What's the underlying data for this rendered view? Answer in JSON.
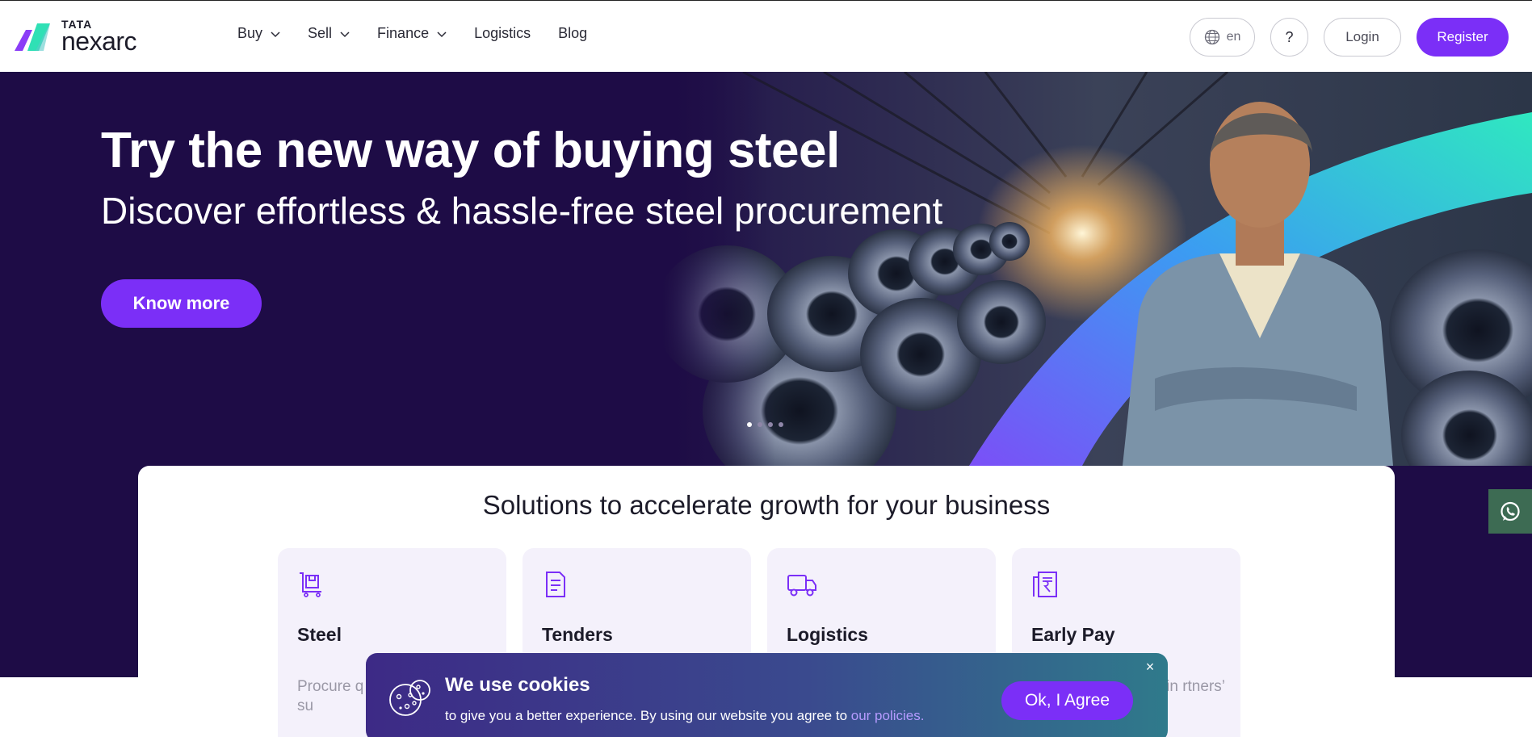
{
  "header": {
    "logo": {
      "brand_top": "TATA",
      "brand_main": "nexarc"
    },
    "nav": [
      {
        "label": "Buy",
        "has_dropdown": true
      },
      {
        "label": "Sell",
        "has_dropdown": true
      },
      {
        "label": "Finance",
        "has_dropdown": true
      },
      {
        "label": "Logistics",
        "has_dropdown": false
      },
      {
        "label": "Blog",
        "has_dropdown": false
      }
    ],
    "language": "en",
    "help_label": "?",
    "login_label": "Login",
    "register_label": "Register"
  },
  "hero": {
    "title": "Try the new way of buying steel",
    "subtitle": "Discover effortless & hassle-free steel procurement",
    "cta_label": "Know more",
    "carousel": {
      "total_slides": 4,
      "active_slide": 1
    }
  },
  "solutions": {
    "title": "Solutions to accelerate growth for your business",
    "cards": [
      {
        "name": "Steel",
        "icon": "cart-icon",
        "desc": "Procure q the best p trusted su"
      },
      {
        "name": "Tenders",
        "icon": "document-icon",
        "desc": ""
      },
      {
        "name": "Logistics",
        "icon": "truck-icon",
        "desc": ""
      },
      {
        "name": "Early Pay",
        "icon": "invoice-rupee-icon",
        "desc": "hain rtners’"
      }
    ]
  },
  "cookie": {
    "title": "We use cookies",
    "text": "to give you a better experience. By using our website you agree to ",
    "link_text": "our policies.",
    "agree_label": "Ok, I Agree",
    "close_label": "×"
  },
  "colors": {
    "brand_purple": "#7b2ff7",
    "hero_bg": "#1e0c46",
    "card_bg": "#f4f1fb",
    "whatsapp_bg": "#3d6b53"
  }
}
